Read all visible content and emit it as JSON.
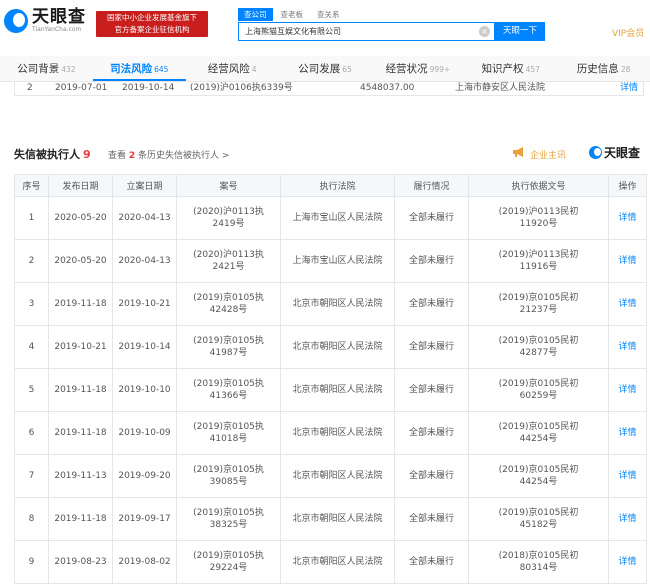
{
  "header": {
    "logo_cn": "天眼查",
    "logo_en": "TianYanCha.com",
    "badge_line1": "国家中小企业发展基金旗下",
    "badge_line2": "官方备案企业征信机构",
    "search_tabs": [
      "查公司",
      "查老板",
      "查关系"
    ],
    "search_value": "上海熊猫互娱文化有限公司",
    "search_button": "天眼一下",
    "vip": "VIP会员"
  },
  "tabs": [
    {
      "label": "公司背景",
      "count": "432"
    },
    {
      "label": "司法风险",
      "count": "645"
    },
    {
      "label": "经营风险",
      "count": "4"
    },
    {
      "label": "公司发展",
      "count": "65"
    },
    {
      "label": "经营状况",
      "count": "999+"
    },
    {
      "label": "知识产权",
      "count": "457"
    },
    {
      "label": "历史信息",
      "count": "28"
    }
  ],
  "prev_row": {
    "seq": "2",
    "pub_date": "2019-07-01",
    "file_date": "2019-10-14",
    "case_no": "(2019)沪0106执6339号",
    "amount": "4548037.00",
    "court": "上海市静安区人民法院",
    "action": "详情"
  },
  "section": {
    "title": "失信被执行人",
    "count": "9",
    "link_prefix": "查看",
    "link_count": "2",
    "link_suffix": "条历史失信被执行人 >",
    "theme_label": "企业主讯",
    "mark_logo": "天眼查"
  },
  "table": {
    "headers": [
      "序号",
      "发布日期",
      "立案日期",
      "案号",
      "执行法院",
      "履行情况",
      "执行依据文号",
      "操作"
    ],
    "rows": [
      {
        "seq": "1",
        "pub": "2020-05-20",
        "file": "2020-04-13",
        "case1": "(2020)沪0113执",
        "case2": "2419号",
        "court": "上海市宝山区人民法院",
        "status": "全部未履行",
        "basis1": "(2019)沪0113民初",
        "basis2": "11920号",
        "action": "详情"
      },
      {
        "seq": "2",
        "pub": "2020-05-20",
        "file": "2020-04-13",
        "case1": "(2020)沪0113执",
        "case2": "2421号",
        "court": "上海市宝山区人民法院",
        "status": "全部未履行",
        "basis1": "(2019)沪0113民初",
        "basis2": "11916号",
        "action": "详情"
      },
      {
        "seq": "3",
        "pub": "2019-11-18",
        "file": "2019-10-21",
        "case1": "(2019)京0105执",
        "case2": "42428号",
        "court": "北京市朝阳区人民法院",
        "status": "全部未履行",
        "basis1": "(2019)京0105民初",
        "basis2": "21237号",
        "action": "详情"
      },
      {
        "seq": "4",
        "pub": "2019-10-21",
        "file": "2019-10-14",
        "case1": "(2019)京0105执",
        "case2": "41987号",
        "court": "北京市朝阳区人民法院",
        "status": "全部未履行",
        "basis1": "(2019)京0105民初",
        "basis2": "42877号",
        "action": "详情"
      },
      {
        "seq": "5",
        "pub": "2019-11-18",
        "file": "2019-10-10",
        "case1": "(2019)京0105执",
        "case2": "41366号",
        "court": "北京市朝阳区人民法院",
        "status": "全部未履行",
        "basis1": "(2019)京0105民初",
        "basis2": "60259号",
        "action": "详情"
      },
      {
        "seq": "6",
        "pub": "2019-11-18",
        "file": "2019-10-09",
        "case1": "(2019)京0105执",
        "case2": "41018号",
        "court": "北京市朝阳区人民法院",
        "status": "全部未履行",
        "basis1": "(2019)京0105民初",
        "basis2": "44254号",
        "action": "详情"
      },
      {
        "seq": "7",
        "pub": "2019-11-13",
        "file": "2019-09-20",
        "case1": "(2019)京0105执",
        "case2": "39085号",
        "court": "北京市朝阳区人民法院",
        "status": "全部未履行",
        "basis1": "(2019)京0105民初",
        "basis2": "44254号",
        "action": "详情"
      },
      {
        "seq": "8",
        "pub": "2019-11-18",
        "file": "2019-09-17",
        "case1": "(2019)京0105执",
        "case2": "38325号",
        "court": "北京市朝阳区人民法院",
        "status": "全部未履行",
        "basis1": "(2019)京0105民初",
        "basis2": "45182号",
        "action": "详情"
      },
      {
        "seq": "9",
        "pub": "2019-08-23",
        "file": "2019-08-02",
        "case1": "(2019)京0105执",
        "case2": "29224号",
        "court": "北京市朝阳区人民法院",
        "status": "全部未履行",
        "basis1": "(2018)京0105民初",
        "basis2": "80314号",
        "action": "详情"
      }
    ]
  },
  "colors": {
    "accent": "#0084ff",
    "badge": "#c81e1e",
    "alert_count": "#e4393c",
    "vip": "#e8a33d"
  }
}
